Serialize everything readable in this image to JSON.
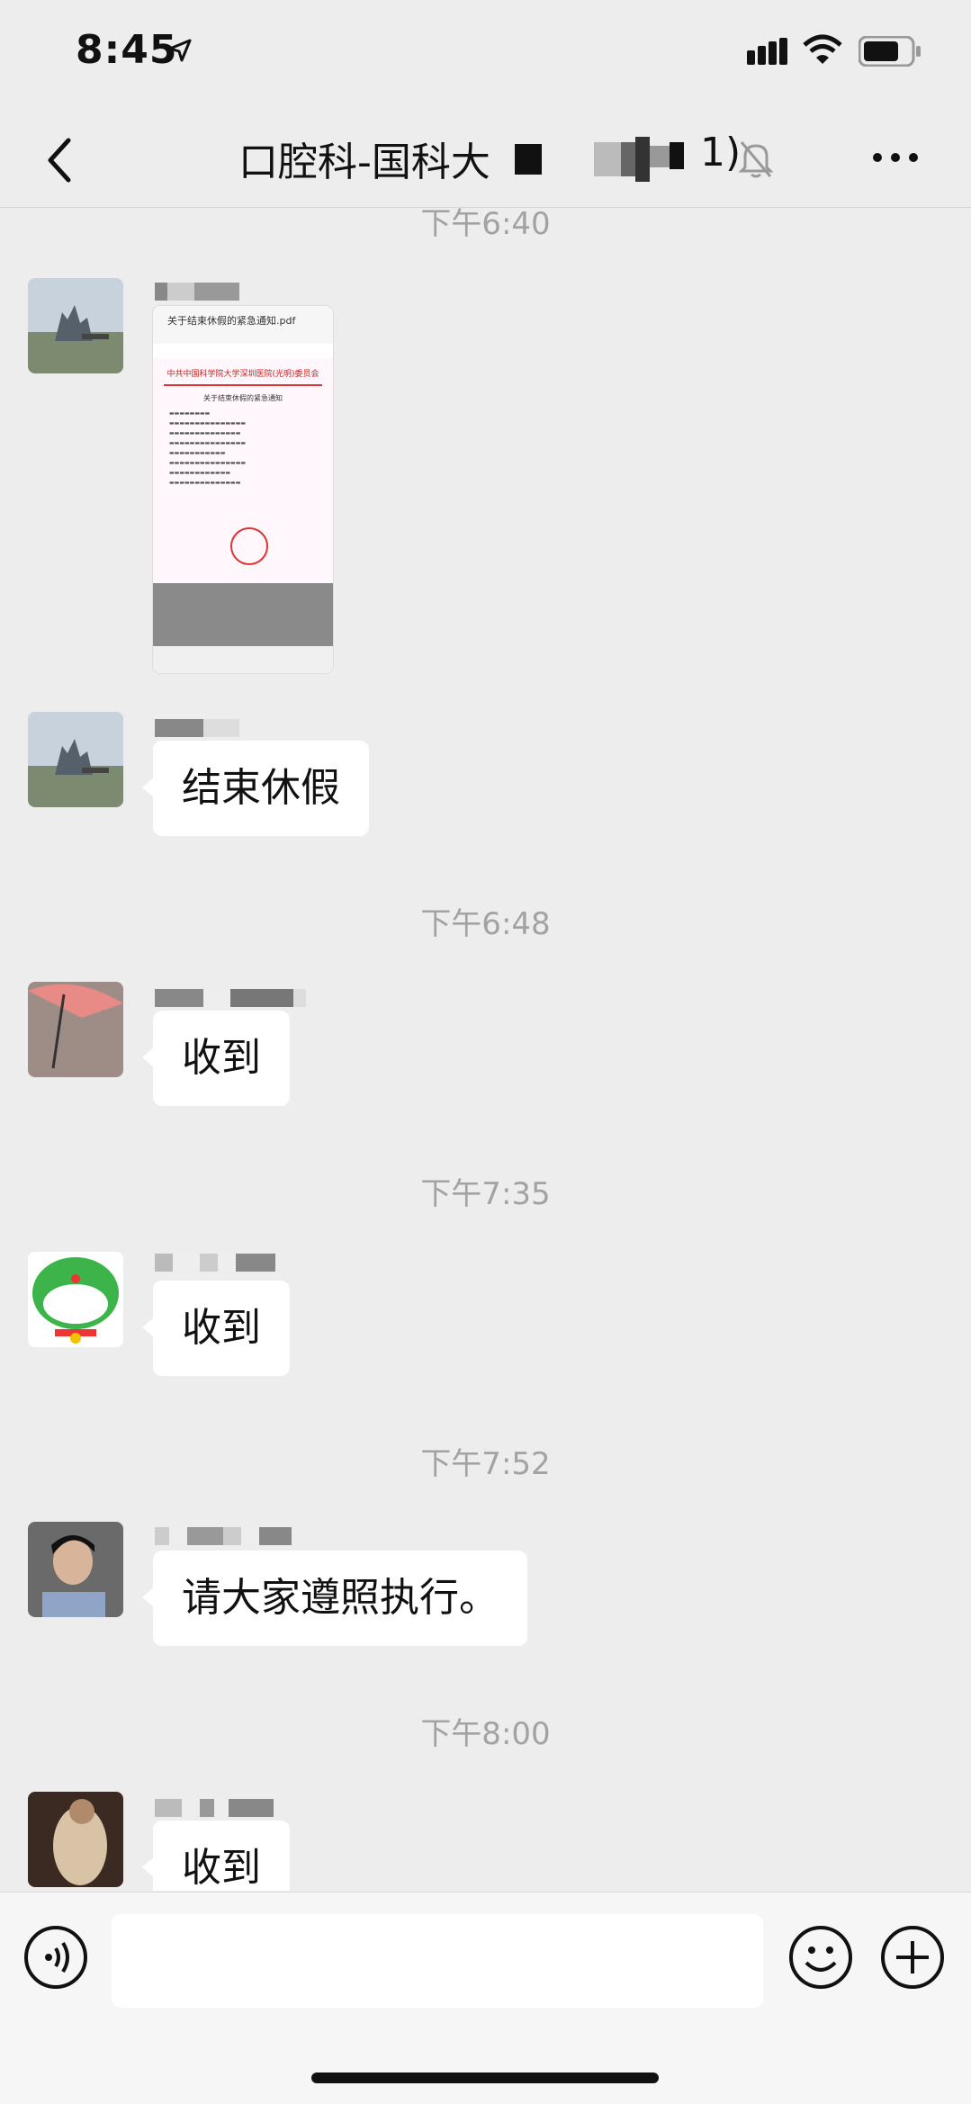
{
  "status_bar": {
    "time": "8:45"
  },
  "header": {
    "title": "口腔科-国科大",
    "title_end": "1)"
  },
  "messages": [
    {
      "timestamp": "下午6:40",
      "type": "file_preview",
      "file": {
        "filename": "关于结束休假的紧急通知.pdf",
        "org": "中共中国科学院大学深圳医院(光明)委员会",
        "heading": "关于结束休假的紧急通知"
      }
    },
    {
      "type": "text",
      "text": "结束休假"
    },
    {
      "timestamp": "下午6:48",
      "type": "text",
      "text": "收到"
    },
    {
      "timestamp": "下午7:35",
      "type": "text",
      "text": "收到"
    },
    {
      "timestamp": "下午7:52",
      "type": "text",
      "text": "请大家遵照执行。"
    },
    {
      "timestamp": "下午8:00",
      "type": "text",
      "text": "收到"
    }
  ],
  "colors": {
    "background": "#ededed",
    "bubble": "#ffffff",
    "timestamp": "#a2a2a2"
  },
  "icons": [
    "location-arrow-icon",
    "signal-icon",
    "wifi-icon",
    "battery-icon",
    "back-chevron-icon",
    "mute-bell-icon",
    "more-icon",
    "voice-icon",
    "emoji-icon",
    "plus-icon"
  ]
}
